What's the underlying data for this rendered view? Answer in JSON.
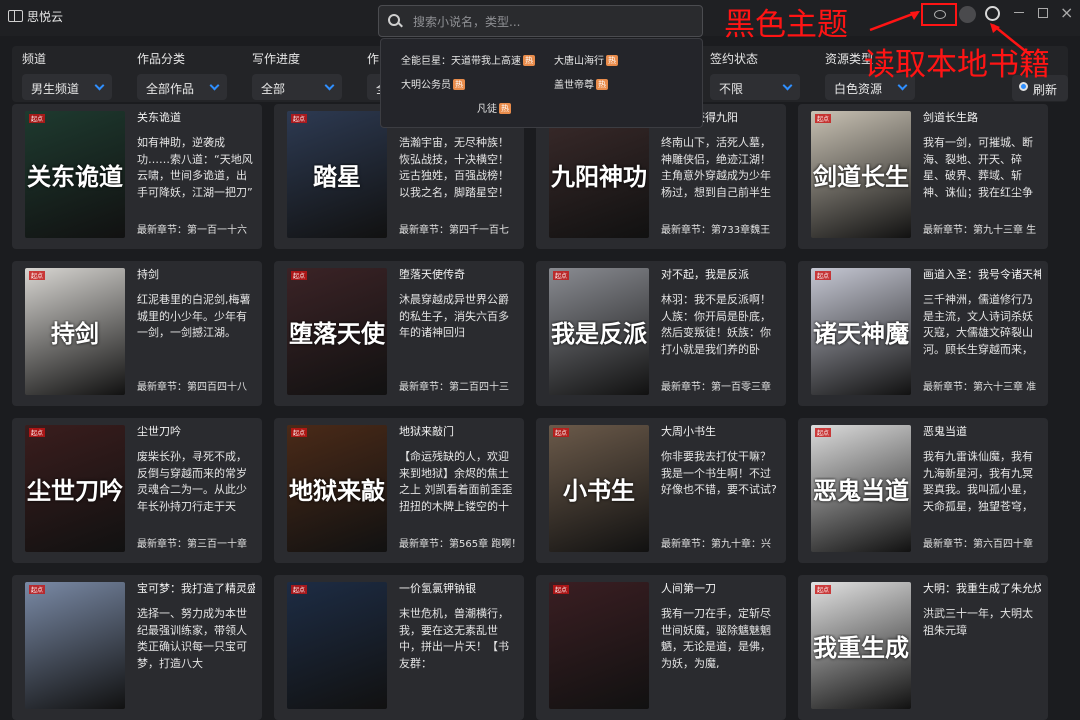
{
  "app": {
    "title": "思悦云"
  },
  "search": {
    "placeholder": "搜索小说名，类型..."
  },
  "annotations": {
    "theme": "黑色主题",
    "local": "读取本地书籍"
  },
  "filters": [
    {
      "label": "频道",
      "value": "男生频道"
    },
    {
      "label": "作品分类",
      "value": "全部作品"
    },
    {
      "label": "写作进度",
      "value": "全部"
    },
    {
      "label": "作",
      "value": "全"
    },
    {
      "label": "签约状态",
      "value": "不限"
    },
    {
      "label": "资源类型",
      "value": "白色资源"
    }
  ],
  "refresh_label": "刷新",
  "suggestions": [
    {
      "text": "全能巨星：天道带我上高速",
      "badge": "热"
    },
    {
      "text": "大唐山海行",
      "badge": "热"
    },
    {
      "text": "大明公务员",
      "badge": "热"
    },
    {
      "text": "盖世帝尊",
      "badge": "热"
    },
    {
      "text": "凡徒",
      "badge": "热"
    }
  ],
  "books": [
    {
      "title": "关东诡道",
      "desc": "如有神助，逆袭成功……索八道：“天地风云啸，世间多诡道，出手可降妖，江湖一把刀”",
      "latest": "最新章节：第一百一十六",
      "cover_text": "关东诡道",
      "cover_color": "#1e3a2f"
    },
    {
      "title": "",
      "desc": "浩瀚宇宙，无尽种族！恢弘战技，十决横空！远古独姓，百强战榜！以我之名，脚踏星空！2200年的一",
      "latest": "最新章节：第四千一百七",
      "cover_text": "踏星",
      "cover_color": "#2d3a52"
    },
    {
      "title": "，开局获得九阳",
      "desc": "终南山下，活死人墓，神雕侠侣，绝迹江湖！主角意外穿越成为少年杨过，想到自己前半生的凄惨人生，他",
      "latest": "最新章节：第733章魏王",
      "cover_text": "九阳神功",
      "cover_color": "#3a2a2a"
    },
    {
      "title": "剑道长生路",
      "desc": "我有一剑，可摧城、断海、裂地、开天、碎星、破界、葬域、斩神、诛仙；我在红尘争渡，与天地争命，与",
      "latest": "最新章节：第九十三章 生",
      "cover_text": "剑道长生路",
      "cover_color": "#c9c2b4"
    },
    {
      "title": "持剑",
      "desc": "红泥巷里的白泥剑,梅薯城里的小少年。少年有一剑，一剑撼江湖。",
      "latest": "最新章节：第四百四十八",
      "cover_text": "持剑",
      "cover_color": "#d8d6d2"
    },
    {
      "title": "堕落天使传奇",
      "desc": "沐晨穿越成异世界公爵的私生子，消失六百多年的诸神回归",
      "latest": "最新章节：第二百四十三",
      "cover_text": "堕落天使",
      "cover_color": "#3b2326"
    },
    {
      "title": "对不起，我是反派",
      "desc": "林羽：我不是反派啊！人族：你开局是卧底，然后变叛徒！妖族：你打小就是我们养的卧底，你背叛就算",
      "latest": "最新章节：第一百零三章",
      "cover_text": "我是反派",
      "cover_color": "#8a8c92"
    },
    {
      "title": "画道入圣：我号令诸天神魔",
      "desc": "三千神洲，儒道修行乃是主流，文人诗词杀妖灭寇，大儒雄文碎裂山河。顾长生穿越而来，却悲催发现，自",
      "latest": "最新章节：第六十三章 准",
      "cover_text": "诸天神魔",
      "cover_color": "#c6c8d4"
    },
    {
      "title": "尘世刀吟",
      "desc": "废柴长孙，寻死不成，反倒与穿越而来的常岁灵魂合二为一。从此少年长孙持刀行走于天下。于尘世中锻刀",
      "latest": "最新章节：第三百一十章",
      "cover_text": "尘世刀吟",
      "cover_color": "#3a1d1d"
    },
    {
      "title": "地狱来敲门",
      "desc": "【命运残缺的人，欢迎来到地狱】余烬的焦土之上 刘凯看着面前歪歪扭扭的木牌上镂空的十二个字 他绝不",
      "latest": "最新章节：第565章 跑啊！",
      "cover_text": "地狱来敲门",
      "cover_color": "#4a2a18"
    },
    {
      "title": "大周小书生",
      "desc": "你非要我去打仗干嘛？我是一个书生啊！不过好像也不错，要不试试?",
      "latest": "最新章节：第九十章：兴",
      "cover_text": "小书生",
      "cover_color": "#6b5a4a"
    },
    {
      "title": "恶鬼当道",
      "desc": "我有九雷诛仙魔，我有九海新星河，我有九冥娶真我。我叫孤小星，天命孤星，独望苍穹，这是我命，也是",
      "latest": "最新章节：第六百四十章",
      "cover_text": "恶鬼当道",
      "cover_color": "#dcdcdc"
    },
    {
      "title": "宝可梦：我打造了精灵盛世",
      "desc": "选择一、努力成为本世纪最强训练家，带领人类正确认识每一只宝可梦，打造八大",
      "latest": "",
      "cover_text": "",
      "cover_color": "#7a8aa6"
    },
    {
      "title": "一价氢氯钾钠银",
      "desc": "末世危机，兽潮横行，我，要在这无素乱世中，拼出一片天！【书友群：",
      "latest": "",
      "cover_text": "",
      "cover_color": "#1d2c44"
    },
    {
      "title": "人间第一刀",
      "desc": "我有一刀在手，定斩尽世间妖魔，驱除魑魅魍魉，无论是道，是佛，为妖，为魔,",
      "latest": "",
      "cover_text": "",
      "cover_color": "#3a1e22"
    },
    {
      "title": "大明：我重生成了朱允炆",
      "desc": "洪武三十一年，大明太祖朱元璋",
      "latest": "",
      "cover_text": "我重生成了朱允炆",
      "cover_color": "#e2e2e2"
    }
  ],
  "colors": {
    "accent": "#2f8fff",
    "annotation": "#ff1414",
    "hot_badge": "#e98c4b",
    "background": "#1b1c1f"
  }
}
